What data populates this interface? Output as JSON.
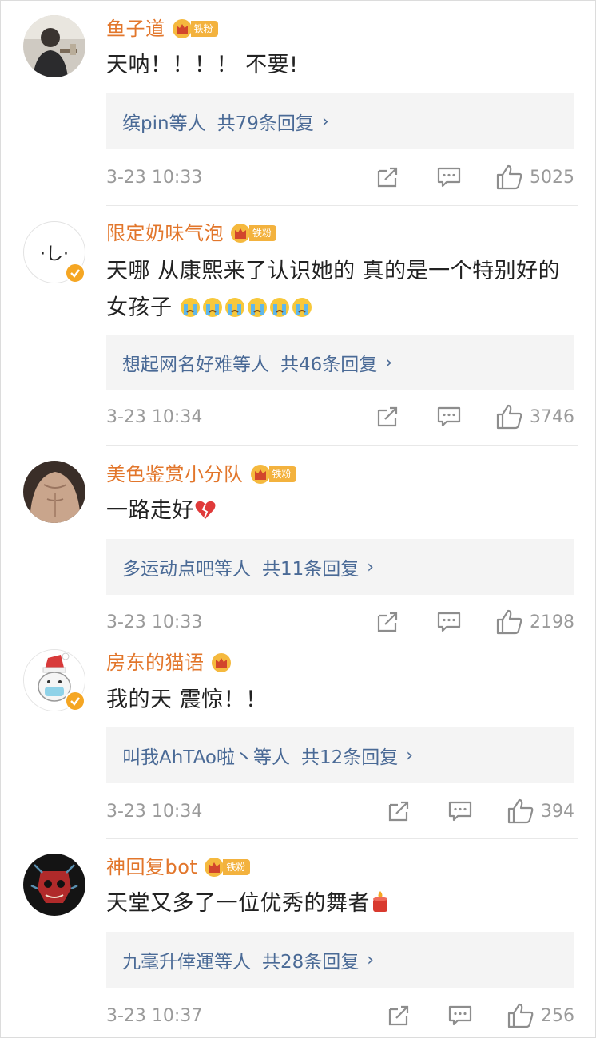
{
  "badge_label": "铁粉",
  "comments": [
    {
      "username": "鱼子道",
      "text": "天呐！！！！ 不要!",
      "reply_users": "缤pin等人",
      "reply_count": "共79条回复",
      "time": "3-23 10:33",
      "likes": "5025"
    },
    {
      "username": "限定奶味气泡",
      "text": "天哪 从康熙来了认识她的 真的是一个特别好的女孩子",
      "reply_users": "想起网名好难等人",
      "reply_count": "共46条回复",
      "time": "3-23 10:34",
      "likes": "3746"
    },
    {
      "username": "美色鉴赏小分队",
      "text": "一路走好",
      "reply_users": "多运动点吧等人",
      "reply_count": "共11条回复",
      "time": "3-23 10:33",
      "likes": "2198"
    },
    {
      "username": "房东的猫语",
      "text": "我的天 震惊！！",
      "reply_users": "叫我AhTAo啦丶等人",
      "reply_count": "共12条回复",
      "time": "3-23 10:34",
      "likes": "394"
    },
    {
      "username": "神回复bot",
      "text": "天堂又多了一位优秀的舞者",
      "reply_users": "九毫升倖運等人",
      "reply_count": "共28条回复",
      "time": "3-23 10:37",
      "likes": "256"
    }
  ],
  "avatar2_text": "·し·",
  "chevron_glyph": "›",
  "icons": {
    "share": "share-icon",
    "comment": "comment-icon",
    "like": "like-icon",
    "crown": "crown-icon",
    "verified": "verified-icon",
    "emoji_cry": "cry-emoji-icon",
    "emoji_broken_heart": "broken-heart-emoji-icon",
    "emoji_candle": "candle-emoji-icon"
  },
  "colors": {
    "username": "#e2762b",
    "reply_link": "#4a6a96",
    "meta": "#9a9a9a",
    "badge": "#f3b23e",
    "reply_bg": "#f4f4f4"
  }
}
